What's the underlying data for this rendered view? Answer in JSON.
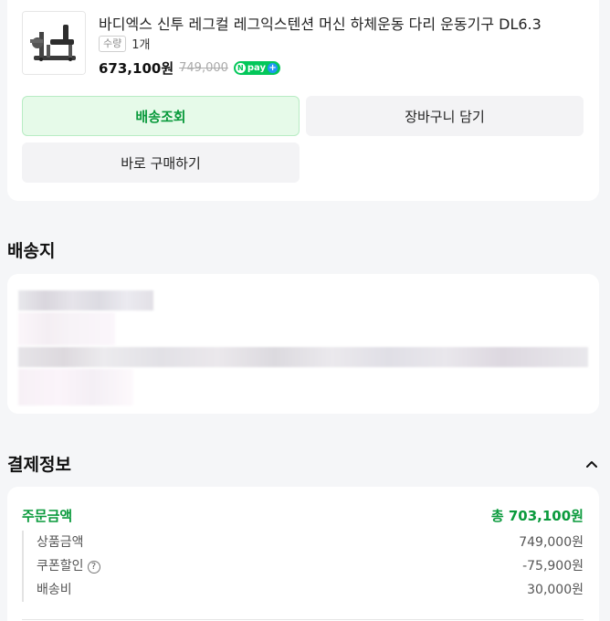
{
  "product": {
    "name": "바디엑스 신투 레그컬 레그익스텐션 머신 하체운동 다리 운동기구 DL6.3",
    "qty_label": "수량",
    "qty_value": "1개",
    "price": "673,100원",
    "original_price": "749,000",
    "npay_label": "pay"
  },
  "buttons": {
    "track": "배송조회",
    "cart": "장바구니 담기",
    "buy": "바로 구매하기"
  },
  "shipping": {
    "title": "배송지"
  },
  "payment": {
    "title": "결제정보",
    "order_amount_label": "주문금액",
    "order_amount_value": "총 703,100원",
    "items": [
      {
        "label": "상품금액",
        "value": "749,000원"
      },
      {
        "label": "쿠폰할인",
        "value": "-75,900원"
      },
      {
        "label": "배송비",
        "value": "30,000원"
      }
    ]
  },
  "colors": {
    "accent_green": "#0a9a3c",
    "track_bg": "#e6fae9",
    "npay_green": "#03c75a"
  }
}
